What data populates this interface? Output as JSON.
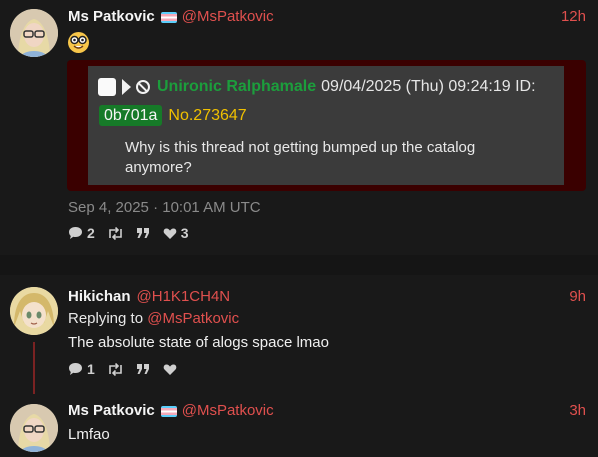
{
  "posts": [
    {
      "display_name": "Ms Patkovic",
      "handle": "@MsPatkovic",
      "time": "12h",
      "emoji": "nerd-face",
      "quote": {
        "name": "Unironic Ralphamale",
        "datetime": "09/04/2025 (Thu) 09:24:19 ID:",
        "id": "0b701a",
        "number": "No.273647",
        "body": "Why is this thread not getting bumped up the catalog anymore?"
      },
      "date": "Sep 4, 2025 · 10:01 AM UTC",
      "replies": "2",
      "likes": "3"
    },
    {
      "display_name": "Hikichan",
      "handle": "@H1K1CH4N",
      "time": "9h",
      "replying_label": "Replying to",
      "replying_handle": "@MsPatkovic",
      "text": "The absolute state of alogs space lmao",
      "replies": "1"
    },
    {
      "display_name": "Ms Patkovic",
      "handle": "@MsPatkovic",
      "time": "3h",
      "text": "Lmfao"
    }
  ],
  "colors": {
    "handle": "#e0504e",
    "quote_frame": "#3a0000",
    "id_badge": "#167a28",
    "post_number": "#f0c000",
    "poster_name": "#1c9e3c"
  }
}
